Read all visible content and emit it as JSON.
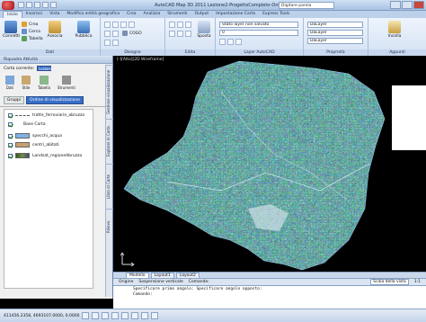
{
  "window": {
    "title": "AutoCAD Map 3D 2011   Lezione2-ProgettoCompleto-Ordinario.dwg",
    "search_placeholder": "Digitare parola",
    "search_value": "Digitare parola"
  },
  "ribbon_tabs": [
    "Inizio",
    "Inserisci",
    "Vista",
    "Modifica entità geografica",
    "Crea",
    "Analizza",
    "Strumenti",
    "Output",
    "Impostazione Carta",
    "Express Tools"
  ],
  "ribbon": {
    "groups": {
      "dati": "Dati",
      "disegno": "Disegno",
      "edita": "Edita",
      "layer": "Layer AutoCAD",
      "proprieta": "Proprietà",
      "appunti": "Appunti"
    },
    "buttons": {
      "connetti": "Connetti",
      "crea": "Crea",
      "cerca": "Cerca",
      "tabella": "Tabella",
      "associa": "Associa",
      "pubblica": "Pubblica",
      "sposta": "Sposta",
      "incolla": "Incolla",
      "cogo": "COGO"
    },
    "layer_state": "Stato layer non salvato",
    "layer_current": "0",
    "prop_color": "DaLayer",
    "prop_linetype": "DaLayer",
    "prop_lineweight": "DaLayer"
  },
  "palette": {
    "title": "Riquadro Attività",
    "current_map_label": "Carta corrente:",
    "current_map_value": "Lezioni",
    "tools": [
      "Dati",
      "Stile",
      "Tabella",
      "Strumenti"
    ],
    "tabs": [
      "Gruppi",
      "Ordine di visualizzazione"
    ],
    "layers": [
      {
        "name": "tratte_ferroviarie_abruzzo",
        "checked": true,
        "color": "#ffffff",
        "indent": 1,
        "kind": "line"
      },
      {
        "name": "Base Carta",
        "checked": true,
        "color": "#ffffff",
        "indent": 0,
        "kind": "group"
      },
      {
        "name": "specchi_acqua",
        "checked": true,
        "color": "#7fb2e8",
        "indent": 1,
        "kind": "swatch"
      },
      {
        "name": "centri_abitati",
        "checked": true,
        "color": "#c8a070",
        "indent": 1,
        "kind": "swatch"
      },
      {
        "name": "Landsat_regioneAbruzzo",
        "checked": true,
        "color": "#3a6a3a",
        "indent": 1,
        "kind": "image"
      }
    ],
    "side_tabs": [
      "Gestione visualizzazione",
      "Explorer di Carta",
      "Libro di Carte",
      "Rilievo"
    ]
  },
  "viewport_label": "[-][Alto][2D Wireframe]",
  "layout_tabs": [
    "Modello",
    "Layout1",
    "Layout2"
  ],
  "map_status": {
    "origin": "Origine",
    "sospensione": "Sospensione verticale",
    "comando": "Comando:",
    "scale": "Scala della vista",
    "scale_value": "1:1"
  },
  "command_lines": [
    "Specificare primo angolo: Specificare angolo opposto:",
    "Comando:"
  ],
  "status_bar": {
    "coords": "411456.2358, 4693107.0000, 0.0000"
  }
}
